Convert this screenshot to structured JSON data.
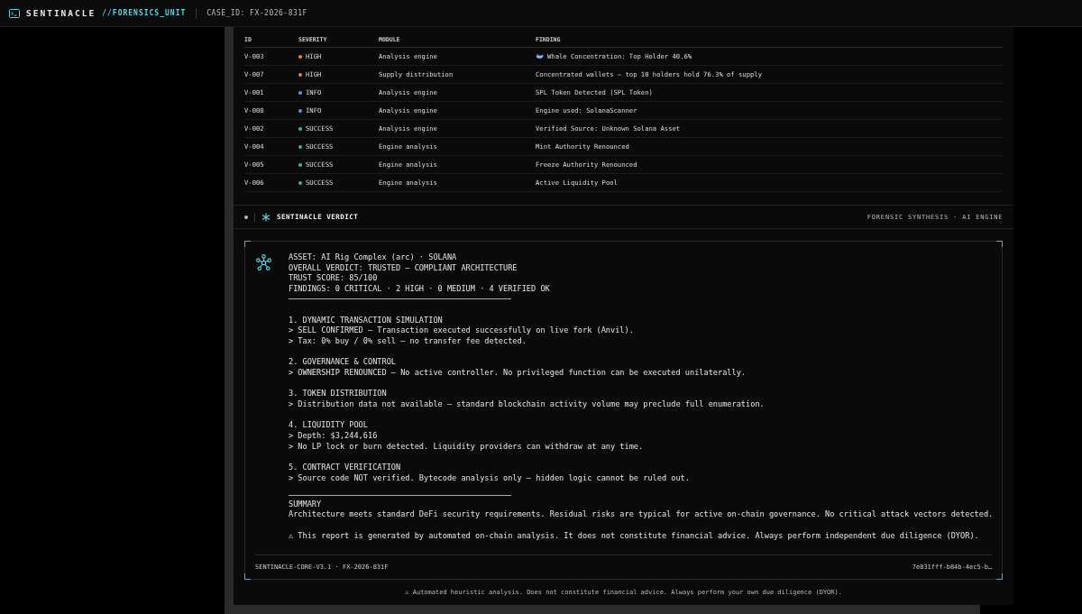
{
  "header": {
    "title": "SENTINACLE",
    "unit": "//FORENSICS_UNIT",
    "case_id": "CASE_ID: FX-2026-831F"
  },
  "table": {
    "columns": [
      "ID",
      "SEVERITY",
      "MODULE",
      "FINDING"
    ],
    "rows": [
      {
        "id": "V-003",
        "severity": "HIGH",
        "color": "#e0894f",
        "module": "Analysis engine",
        "finding": "Whale Concentration: Top Holder 40.6%",
        "has_icon": true
      },
      {
        "id": "V-007",
        "severity": "HIGH",
        "color": "#e0894f",
        "module": "Supply distribution",
        "finding": "Concentrated wallets — top 10 holders hold 76.3% of supply",
        "has_icon": false
      },
      {
        "id": "V-001",
        "severity": "INFO",
        "color": "#6f8fe6",
        "module": "Analysis engine",
        "finding": "SPL Token Detected (SPL Token)",
        "has_icon": false
      },
      {
        "id": "V-008",
        "severity": "INFO",
        "color": "#6f8fe6",
        "module": "Analysis engine",
        "finding": "Engine used: SolanaScanner",
        "has_icon": false
      },
      {
        "id": "V-002",
        "severity": "SUCCESS",
        "color": "#4fb477",
        "module": "Analysis engine",
        "finding": "Verified Source: Unknown Solana Asset",
        "has_icon": false
      },
      {
        "id": "V-004",
        "severity": "SUCCESS",
        "color": "#4fb477",
        "module": "Engine analysis",
        "finding": "Mint Authority Renounced",
        "has_icon": false
      },
      {
        "id": "V-005",
        "severity": "SUCCESS",
        "color": "#4fb477",
        "module": "Engine analysis",
        "finding": "Freeze Authority Renounced",
        "has_icon": false
      },
      {
        "id": "V-006",
        "severity": "SUCCESS",
        "color": "#4fb477",
        "module": "Engine analysis",
        "finding": "Active Liquidity Pool",
        "has_icon": false
      }
    ]
  },
  "verdict": {
    "title": "SENTINACLE VERDICT",
    "subtitle": "FORENSIC SYNTHESIS · AI ENGINE",
    "overview": [
      "ASSET: AI Rig Complex (arc) · SOLANA",
      "OVERALL VERDICT: TRUSTED — COMPLIANT ARCHITECTURE",
      "TRUST SCORE: 85/100",
      "FINDINGS: 0 CRITICAL · 2 HIGH · 0 MEDIUM · 4 VERIFIED OK"
    ],
    "sections": [
      {
        "heading": "1. DYNAMIC TRANSACTION SIMULATION",
        "lines": [
          "> SELL CONFIRMED — Transaction executed successfully on live fork (Anvil).",
          "> Tax: 0% buy / 0% sell — no transfer fee detected."
        ]
      },
      {
        "heading": "2. GOVERNANCE & CONTROL",
        "lines": [
          "> OWNERSHIP RENOUNCED — No active controller. No privileged function can be executed unilaterally."
        ]
      },
      {
        "heading": "3. TOKEN DISTRIBUTION",
        "lines": [
          "> Distribution data not available — standard blockchain activity volume may preclude full enumeration."
        ]
      },
      {
        "heading": "4. LIQUIDITY POOL",
        "lines": [
          "> Depth: $3,244,616",
          "> No LP lock or burn detected. Liquidity providers can withdraw at any time."
        ]
      },
      {
        "heading": "5. CONTRACT VERIFICATION",
        "lines": [
          "> Source code NOT verified. Bytecode analysis only — hidden logic cannot be ruled out."
        ]
      }
    ],
    "summary_heading": "SUMMARY",
    "summary": "Architecture meets standard DeFi security requirements. Residual risks are typical for active on-chain governance. No critical attack vectors detected.",
    "disclaimer": "⚠ This report is generated by automated on-chain analysis. It does not constitute financial advice. Always perform independent due diligence (DYOR).",
    "footer_left": "SENTINACLE-CORE-V3.1 · FX-2026-831F",
    "footer_right": "7e831fff-b84b-4ec5-b…"
  },
  "footer_note": "⚠ Automated heuristic analysis. Does not constitute financial advice. Always perform your own due diligence (DYOR)."
}
